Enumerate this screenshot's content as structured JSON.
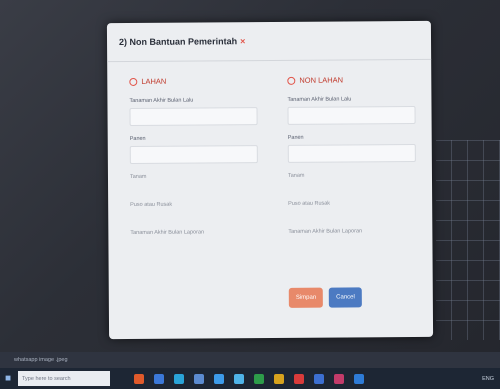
{
  "modal": {
    "title": "2) Non Bantuan Pemerintah",
    "close_symbol": "×",
    "left": {
      "heading": "LAHAN",
      "fields": [
        {
          "label": "Tanaman Akhir Bulan Lalu"
        },
        {
          "label": "Panen"
        }
      ],
      "labels": [
        "Tanam",
        "Puso atau Rusak",
        "Tanaman Akhir Bulan Laporan"
      ]
    },
    "right": {
      "heading": "NON LAHAN",
      "fields": [
        {
          "label": "Tanaman Akhir Bulan Lalu"
        },
        {
          "label": "Panen"
        }
      ],
      "labels": [
        "Tanam",
        "Puso atau Rusak",
        "Tanaman Akhir Bulan Laporan"
      ]
    },
    "buttons": {
      "save": "Simpan",
      "cancel": "Cancel"
    }
  },
  "download_bar": {
    "filename": "whatsapp image .jpeg"
  },
  "taskbar": {
    "search_placeholder": "Type here to search",
    "tray_text": "ENG"
  },
  "colors": {
    "accent_red": "#e2554a",
    "save_button": "#e8896a",
    "cancel_button": "#4c7ac2"
  }
}
